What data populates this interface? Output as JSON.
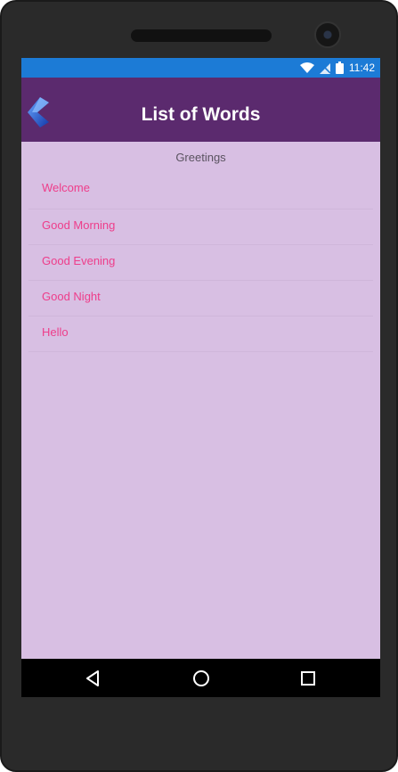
{
  "status_bar": {
    "time": "11:42",
    "icons": [
      "wifi-icon",
      "no-sim-icon",
      "battery-icon"
    ]
  },
  "app_bar": {
    "title": "List of Words",
    "back_icon": "back-arrow-icon"
  },
  "group": {
    "header": "Greetings",
    "items": [
      "Welcome",
      "Good Morning",
      "Good Evening",
      "Good Night",
      "Hello"
    ]
  },
  "nav_bar": {
    "icons": [
      "back-triangle-icon",
      "home-circle-icon",
      "recents-square-icon"
    ]
  },
  "colors": {
    "status_bar": "#1c7bd6",
    "app_bar": "#5b2a6e",
    "background": "#d8bfe3",
    "item_text": "#ee3d8a"
  }
}
